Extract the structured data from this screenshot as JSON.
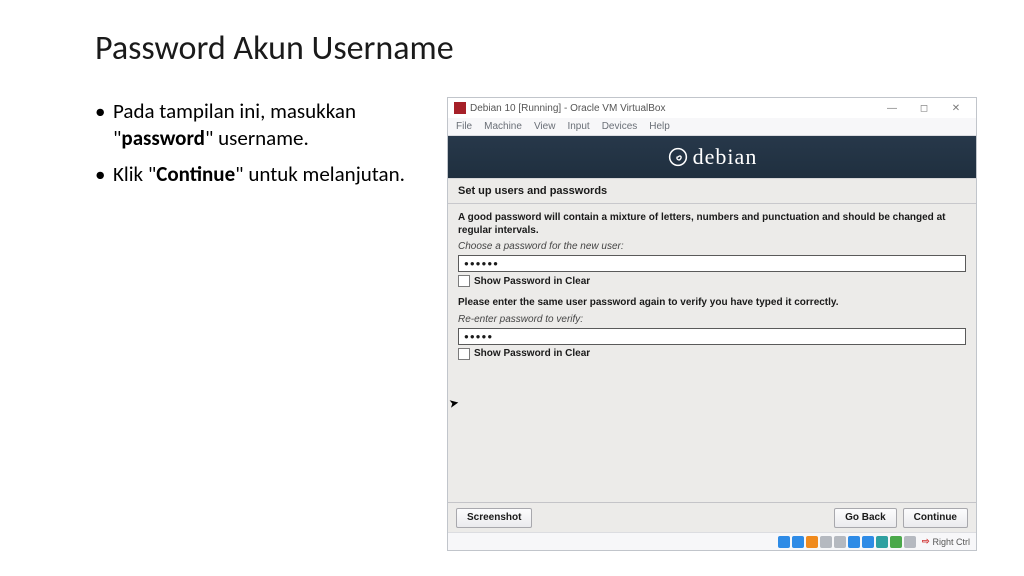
{
  "slide": {
    "title": "Password Akun Username",
    "bullet1_a": "Pada tampilan ini, masukkan \"",
    "bullet1_b": "password",
    "bullet1_c": "\" username.",
    "bullet2_a": "Klik \"",
    "bullet2_b": "Continue",
    "bullet2_c": "\" untuk melanjutan."
  },
  "vm": {
    "title": "Debian 10 [Running] - Oracle VM VirtualBox",
    "winbtn_min": "—",
    "winbtn_max": "◻",
    "winbtn_close": "✕",
    "menus": [
      "File",
      "Machine",
      "View",
      "Input",
      "Devices",
      "Help"
    ],
    "logo_text": "debian",
    "heading": "Set up users and passwords",
    "hint1": "A good password will contain a mixture of letters, numbers and punctuation and should be changed at regular intervals.",
    "hint2_italic": "Choose a password for the new user:",
    "pw1_value": "●●●●●●",
    "chk1_label": "Show Password in Clear",
    "hint3": "Please enter the same user password again to verify you have typed it correctly.",
    "hint4_italic": "Re-enter password to verify:",
    "pw2_value": "●●●●●",
    "chk2_label": "Show Password in Clear",
    "btn_screenshot": "Screenshot",
    "btn_back": "Go Back",
    "btn_continue": "Continue",
    "status_right": "Right Ctrl",
    "status_arrow": "⇨"
  }
}
